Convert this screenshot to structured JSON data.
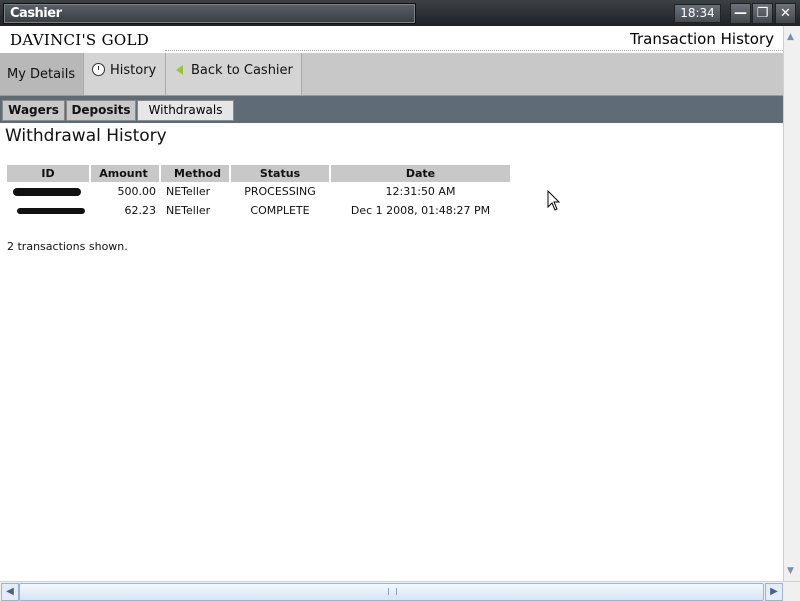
{
  "window": {
    "title": "Cashier",
    "clock": "18:34",
    "minimize_glyph": "—",
    "restore_glyph": "❐",
    "close_glyph": "✕"
  },
  "header": {
    "brand": "DAVINCI'S GOLD",
    "page_title": "Transaction History"
  },
  "main_nav": {
    "items": [
      {
        "label": "My Details",
        "icon": null
      },
      {
        "label": "History",
        "icon": "clock-icon"
      },
      {
        "label": "Back to Cashier",
        "icon": "back-arrow-icon"
      }
    ]
  },
  "sub_nav": {
    "tabs": [
      {
        "label": "Wagers"
      },
      {
        "label": "Deposits"
      },
      {
        "label": "Withdrawals",
        "active": true
      }
    ]
  },
  "content": {
    "heading": "Withdrawal History",
    "table": {
      "columns": [
        "ID",
        "Amount",
        "Method",
        "Status",
        "Date"
      ],
      "rows": [
        {
          "id": "",
          "amount": "500.00",
          "method": "NETeller",
          "status": "PROCESSING",
          "date": "12:31:50 AM"
        },
        {
          "id": "",
          "amount": "62.23",
          "method": "NETeller",
          "status": "COMPLETE",
          "date": "Dec 1 2008, 01:48:27 PM"
        }
      ]
    },
    "summary": "2 transactions shown."
  },
  "colors": {
    "subnav_bg": "#5e6c78",
    "nav_bg": "#c8c8c8",
    "back_arrow": "#9bc23a"
  }
}
